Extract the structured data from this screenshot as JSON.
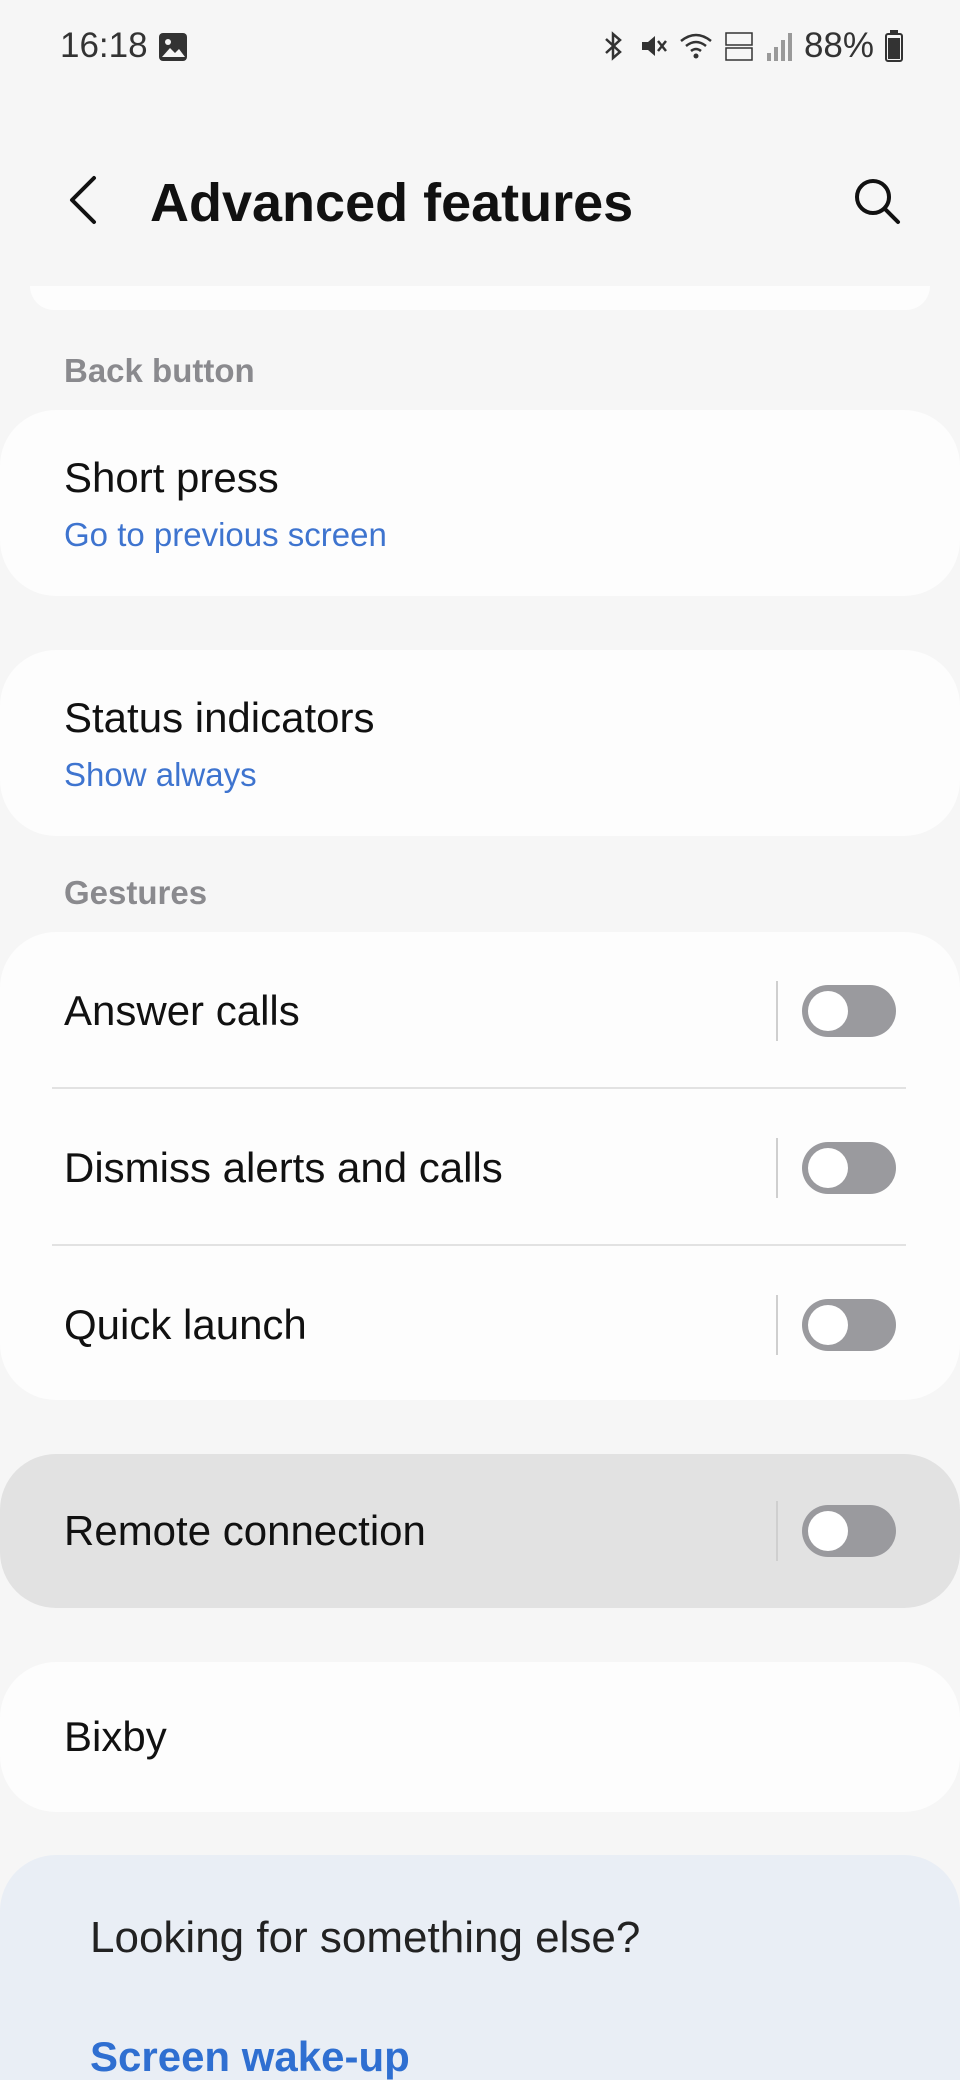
{
  "status_bar": {
    "time": "16:18",
    "battery": "88%",
    "icons": [
      "gallery-icon",
      "bluetooth-icon",
      "mute-icon",
      "wifi-icon",
      "volte-icon",
      "signal-icon",
      "battery-icon"
    ]
  },
  "header": {
    "title": "Advanced features",
    "back_icon": "chevron-left-icon",
    "search_icon": "search-icon"
  },
  "back_button_section": {
    "label": "Back button",
    "short_press": {
      "title": "Short press",
      "value": "Go to previous screen"
    }
  },
  "status_indicators": {
    "title": "Status indicators",
    "value": "Show always"
  },
  "gestures_section": {
    "label": "Gestures",
    "items": [
      {
        "title": "Answer calls",
        "enabled": false
      },
      {
        "title": "Dismiss alerts and calls",
        "enabled": false
      },
      {
        "title": "Quick launch",
        "enabled": false
      }
    ]
  },
  "remote_connection": {
    "title": "Remote connection",
    "enabled": false
  },
  "bixby": {
    "title": "Bixby"
  },
  "looking_for": {
    "title": "Looking for something else?",
    "link": "Screen wake-up"
  },
  "colors": {
    "background": "#f6f6f6",
    "card": "#fdfdfd",
    "accent": "#3e74cf",
    "toggle_off": "#9a9a9e",
    "highlight": "#e2e2e2",
    "suggestion_bg": "#e9eef5"
  }
}
